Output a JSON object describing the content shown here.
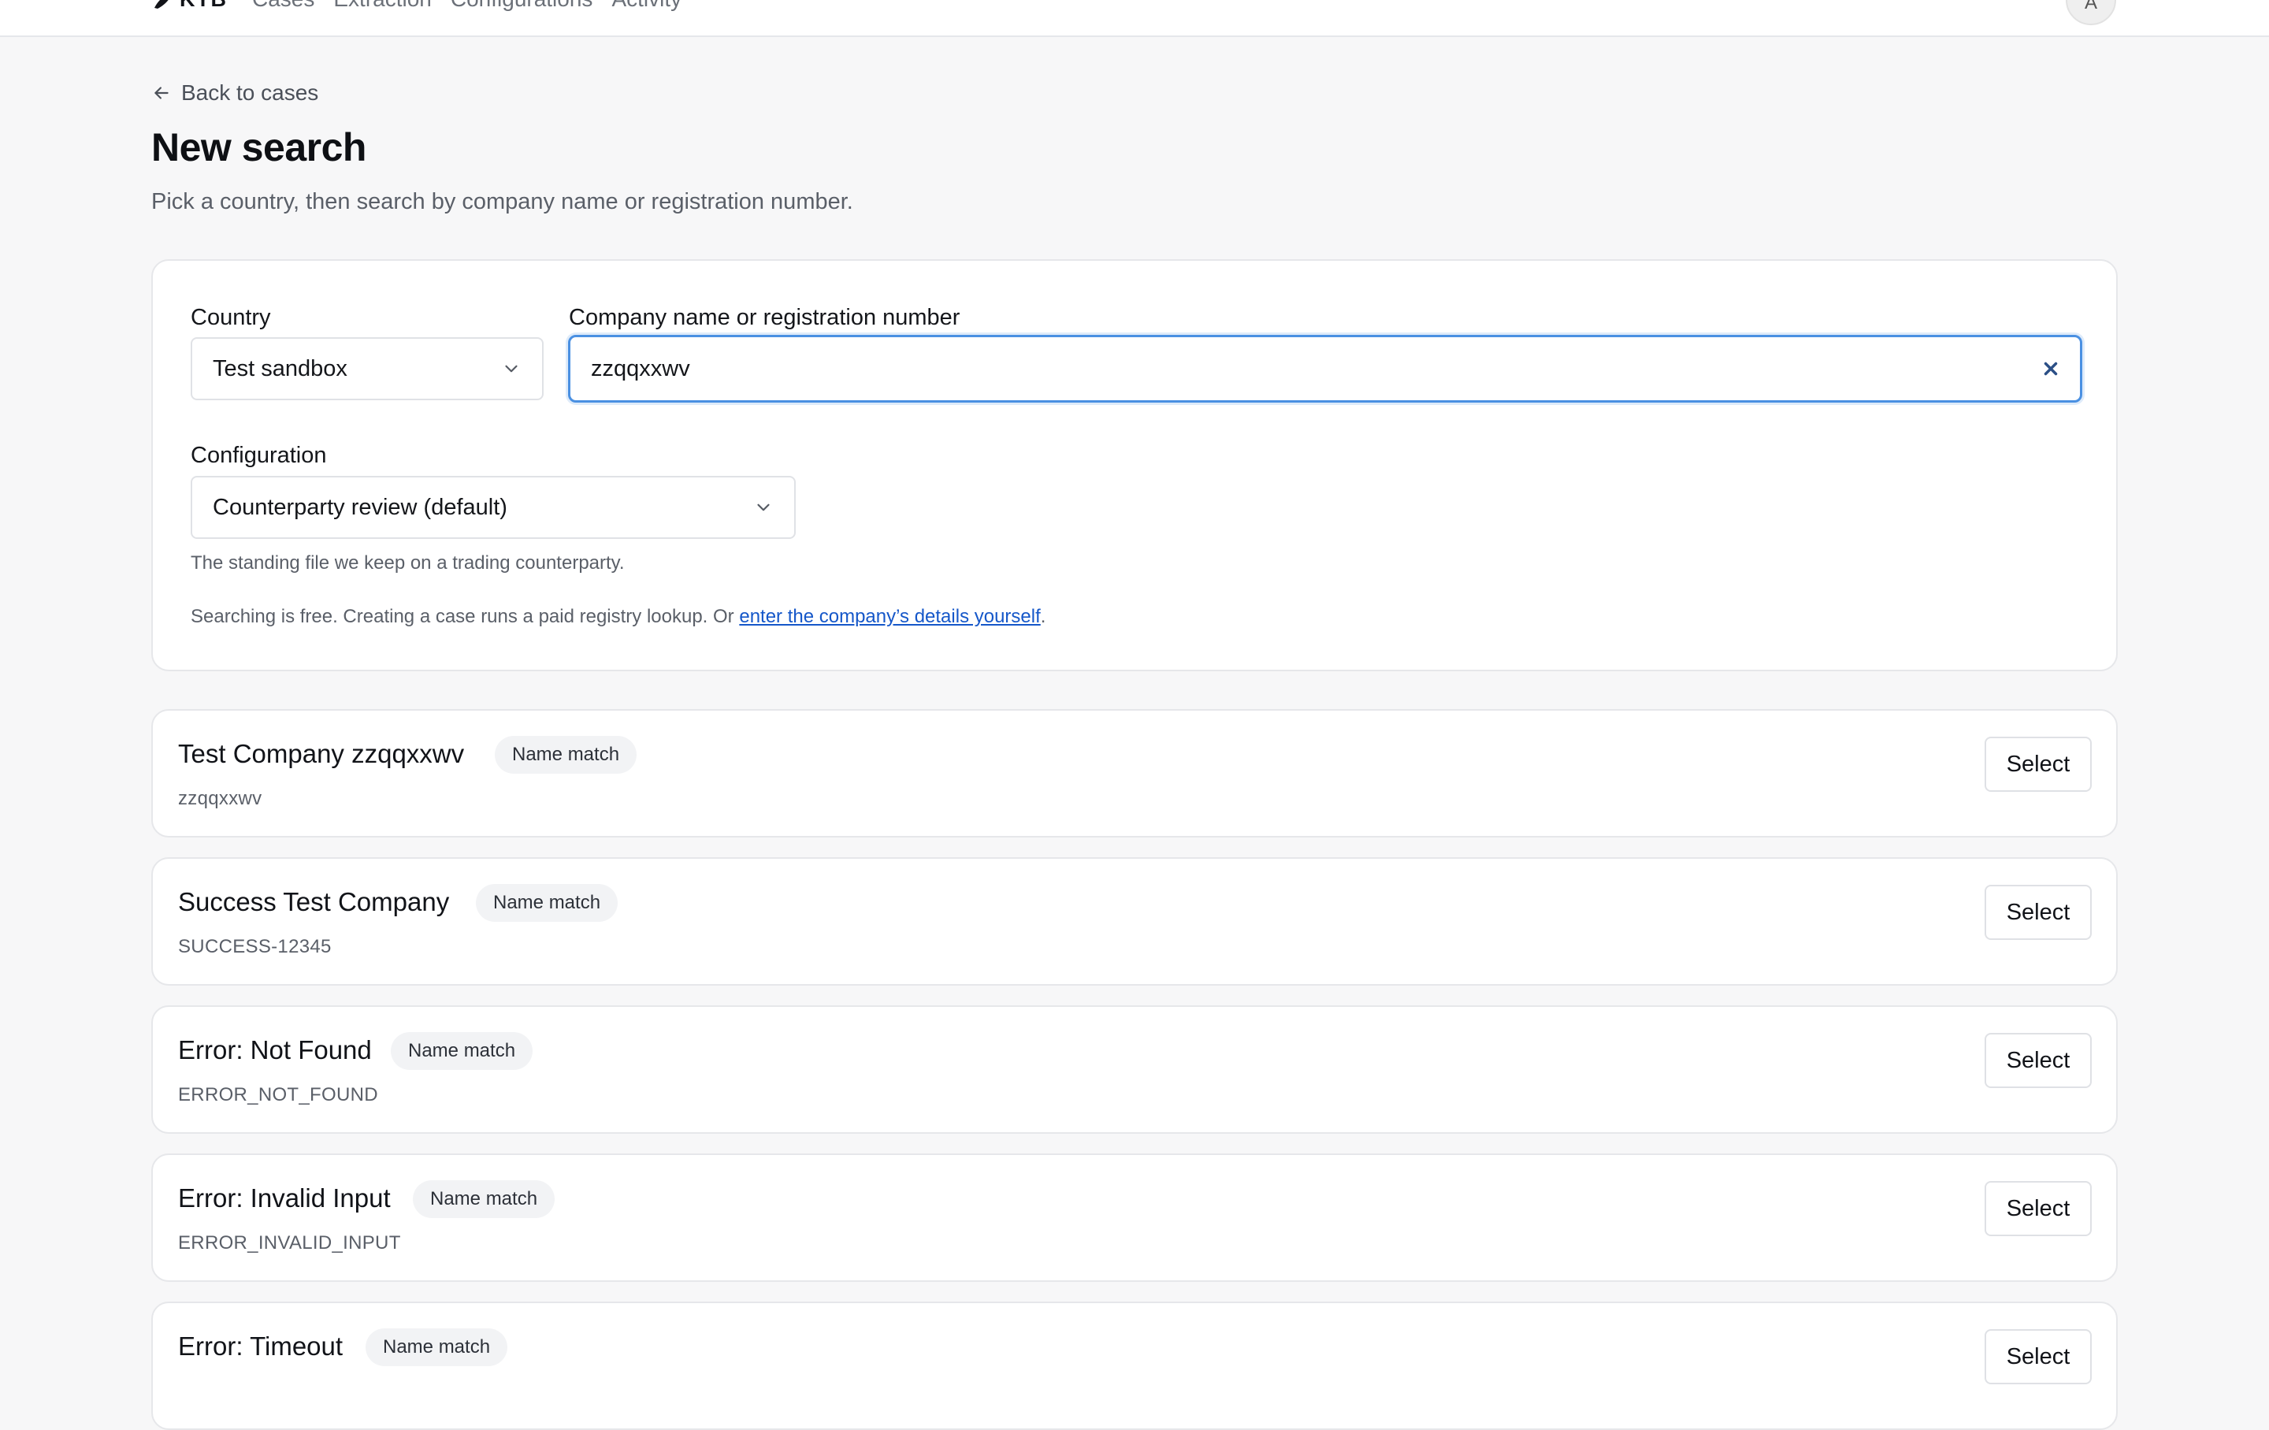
{
  "header": {
    "logo_text": "KYB",
    "nav": [
      "Cases",
      "Extraction",
      "Configurations",
      "Activity"
    ],
    "avatar_initial": "A"
  },
  "back_link": "Back to cases",
  "title": "New search",
  "subtitle": "Pick a country, then search by company name or registration number.",
  "form": {
    "country_label": "Country",
    "country_value": "Test sandbox",
    "query_label": "Company name or registration number",
    "query_value": "zzqqxxwv",
    "config_label": "Configuration",
    "config_value": "Counterparty review (default)",
    "config_help": "The standing file we keep on a trading counterparty.",
    "notice_prefix": "Searching is free. Creating a case runs a paid registry lookup. Or ",
    "notice_link": "enter the company’s details yourself",
    "notice_suffix": "."
  },
  "results": [
    {
      "name": "Test Company zzqqxxwv",
      "badge": "Name match",
      "id": "zzqqxxwv",
      "action": "Select"
    },
    {
      "name": "Success Test Company",
      "badge": "Name match",
      "id": "SUCCESS-12345",
      "action": "Select"
    },
    {
      "name": "Error: Not Found",
      "badge": "Name match",
      "id": "ERROR_NOT_FOUND",
      "action": "Select"
    },
    {
      "name": "Error: Invalid Input",
      "badge": "Name match",
      "id": "ERROR_INVALID_INPUT",
      "action": "Select"
    },
    {
      "name": "Error: Timeout",
      "badge": "Name match",
      "id": "",
      "action": "Select"
    }
  ],
  "colors": {
    "accent": "#4a90e2",
    "link": "#1557c9",
    "background": "#f7f7f8"
  }
}
